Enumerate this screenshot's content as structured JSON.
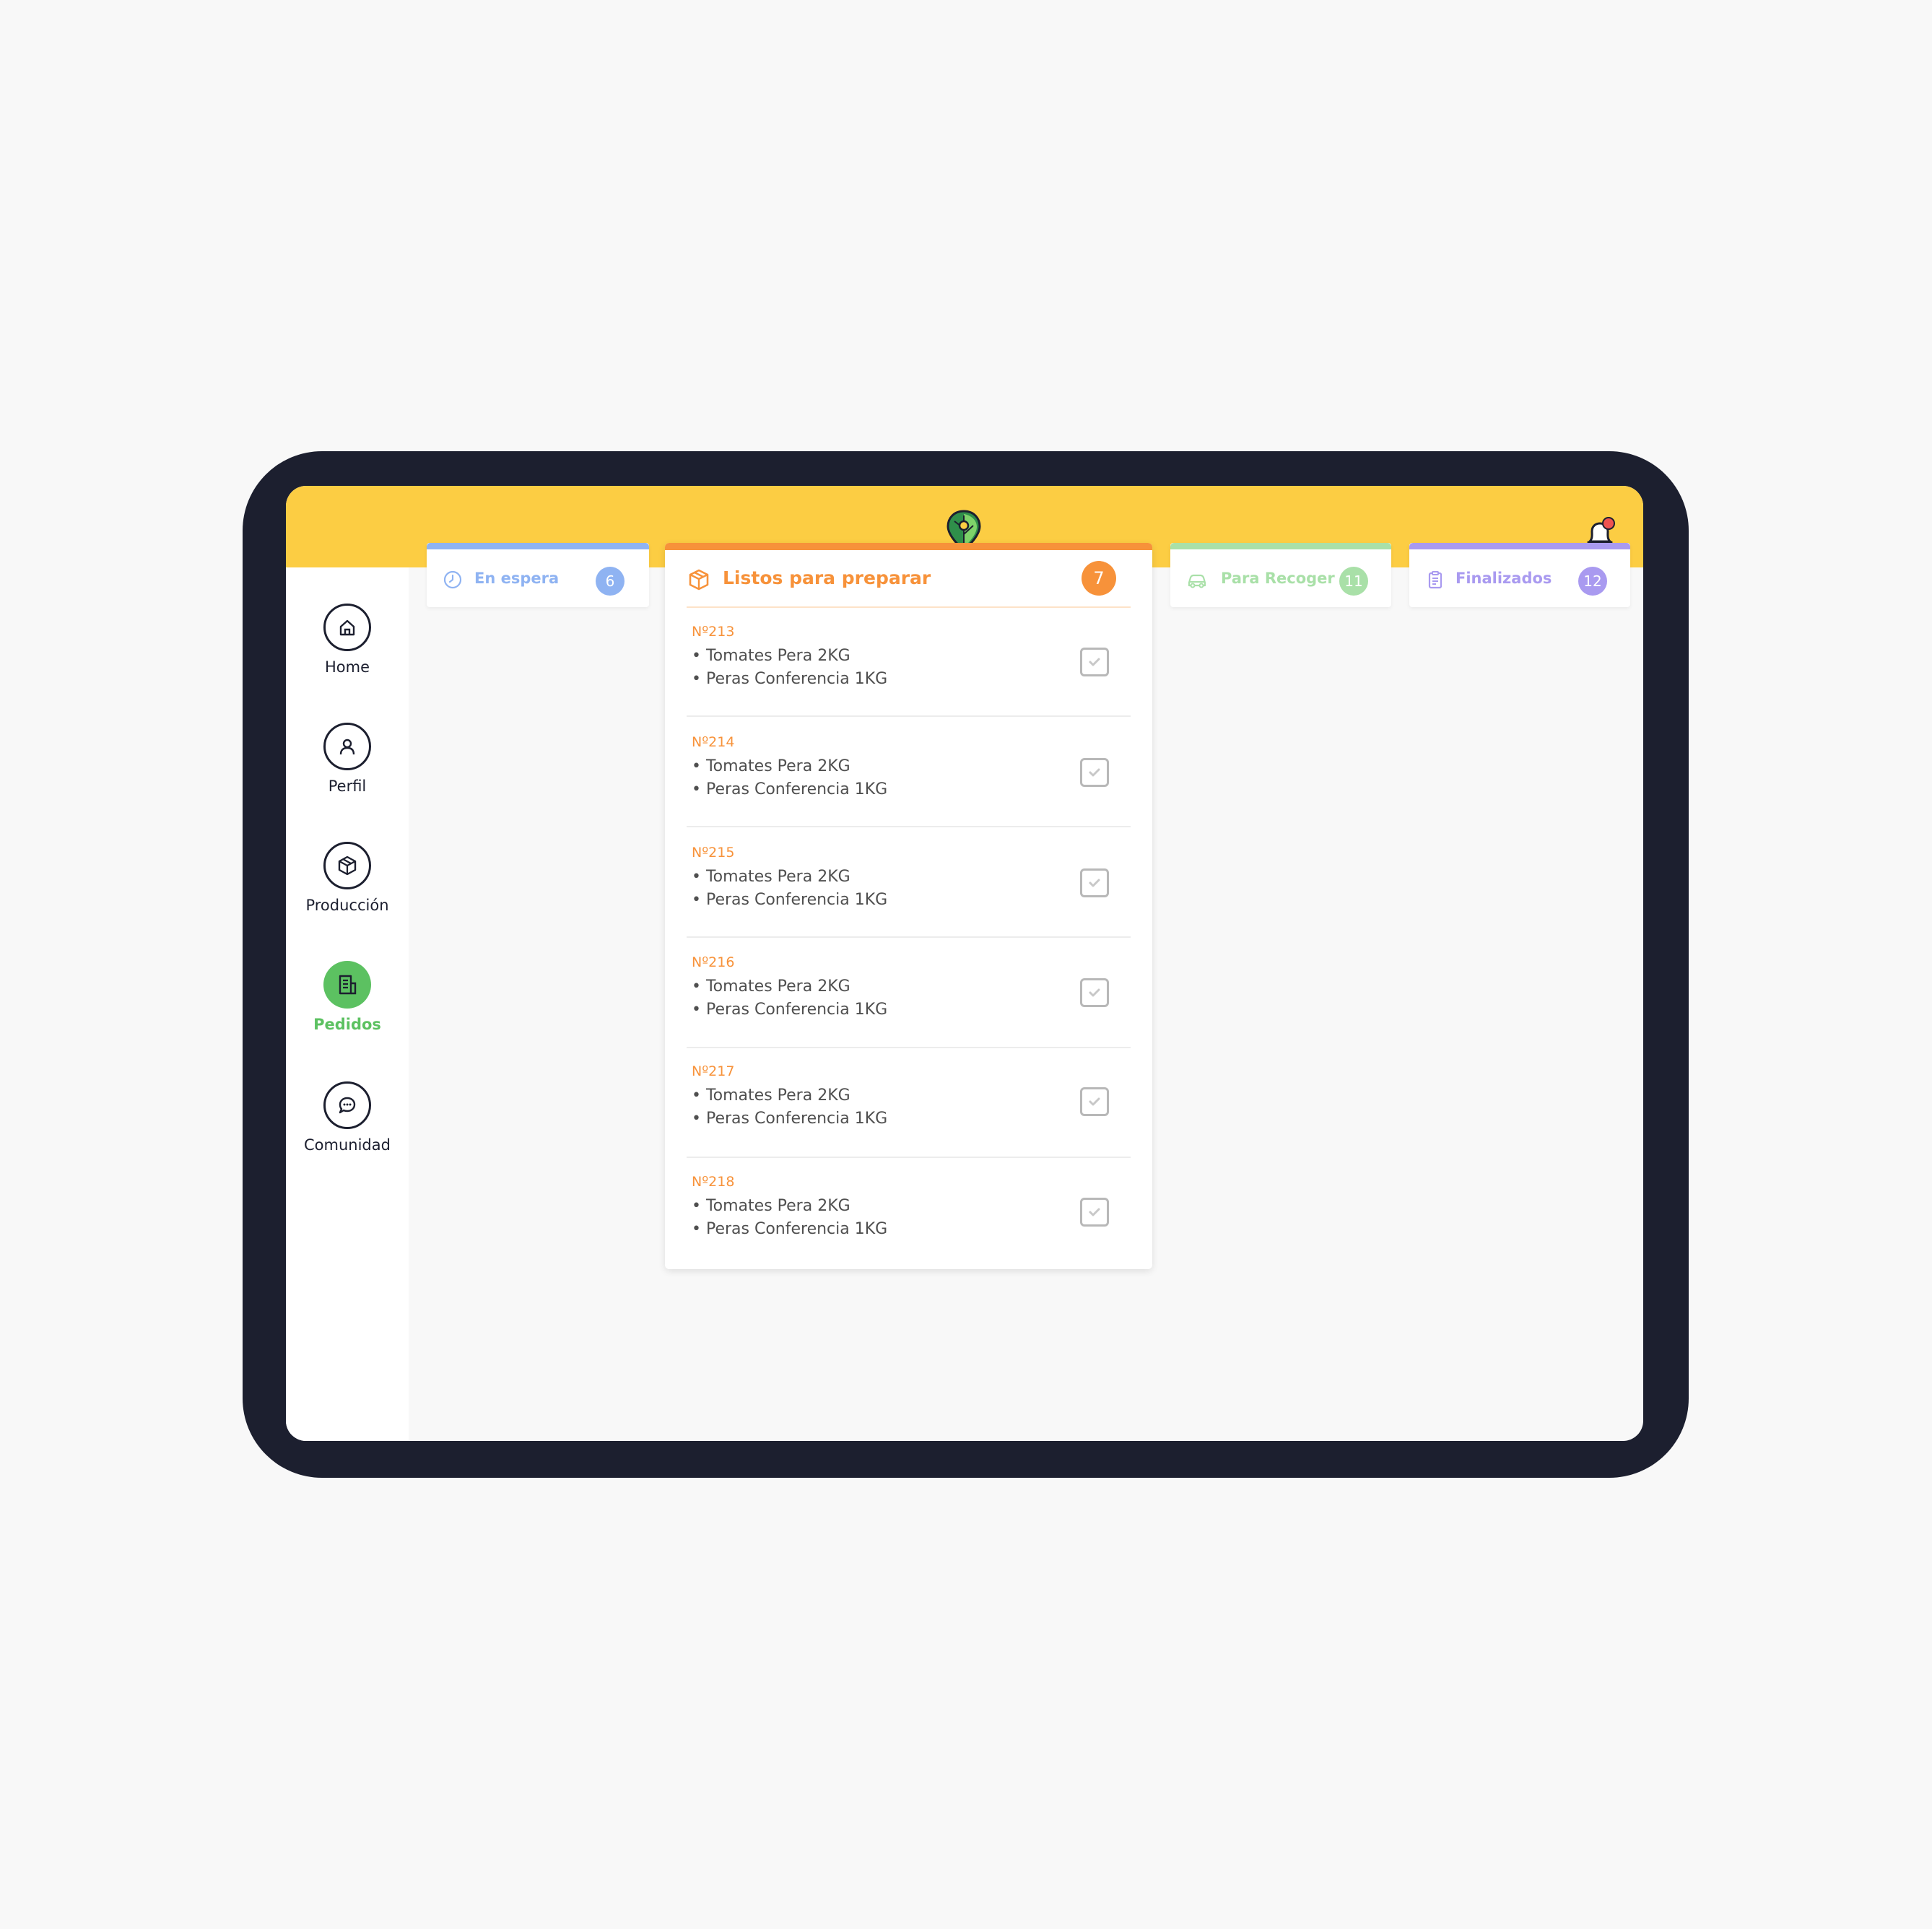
{
  "nav": {
    "items": [
      {
        "label": "Home",
        "icon": "home-icon"
      },
      {
        "label": "Perfil",
        "icon": "user-icon"
      },
      {
        "label": "Producción",
        "icon": "package-icon"
      },
      {
        "label": "Pedidos",
        "icon": "receipt-icon",
        "active": true
      },
      {
        "label": "Comunidad",
        "icon": "chat-icon"
      }
    ]
  },
  "columns": {
    "en_espera": {
      "title": "En espera",
      "count": "6",
      "color": "#8fb3f2"
    },
    "listos": {
      "title": "Listos para preparar",
      "count": "7",
      "color": "#f7923a"
    },
    "para_recoger": {
      "title": "Para Recoger",
      "count": "11",
      "color": "#a9e0a8"
    },
    "finalizados": {
      "title": "Finalizados",
      "count": "12",
      "color": "#a99af0"
    }
  },
  "orders": [
    {
      "number": "Nº213",
      "items": [
        "• Tomates Pera 2KG",
        "• Peras Conferencia 1KG"
      ]
    },
    {
      "number": "Nº214",
      "items": [
        "• Tomates Pera 2KG",
        "• Peras Conferencia 1KG"
      ]
    },
    {
      "number": "Nº215",
      "items": [
        "• Tomates Pera 2KG",
        "• Peras Conferencia 1KG"
      ]
    },
    {
      "number": "Nº216",
      "items": [
        "• Tomates Pera 2KG",
        "• Peras Conferencia 1KG"
      ]
    },
    {
      "number": "Nº217",
      "items": [
        "• Tomates Pera 2KG",
        "• Peras Conferencia 1KG"
      ]
    },
    {
      "number": "Nº218",
      "items": [
        "• Tomates Pera 2KG",
        "• Peras Conferencia 1KG"
      ]
    }
  ],
  "colors": {
    "topbar": "#fccd43",
    "device_frame": "#1c1f2f",
    "active_nav": "#5cc161",
    "notification_dot": "#ef5350"
  }
}
